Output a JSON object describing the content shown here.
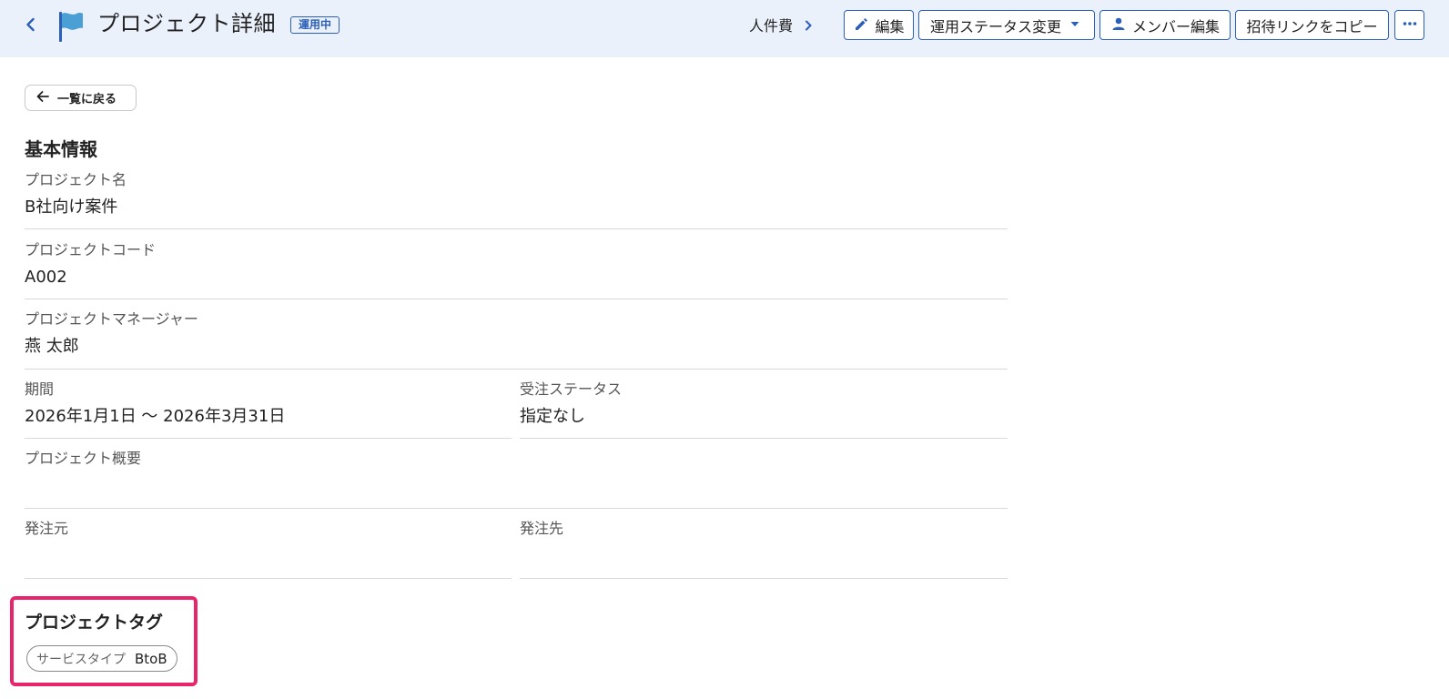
{
  "header": {
    "title": "プロジェクト詳細",
    "status_badge": "運用中",
    "breadcrumb_link": "人件費",
    "buttons": {
      "edit": "編集",
      "status_change": "運用ステータス変更",
      "member_edit": "メンバー編集",
      "copy_invite": "招待リンクをコピー"
    },
    "icons": {
      "back": "chevron-left-icon",
      "flag": "flag-icon",
      "edit": "pencil-icon",
      "status": "caret-down-icon",
      "member": "person-icon",
      "more": "more-horizontal-icon"
    },
    "colors": {
      "accent": "#2b5fb8",
      "flag": "#4a9fd4",
      "header_bg": "#ebf1fb",
      "highlight": "#e8256a"
    }
  },
  "back_button": "一覧に戻る",
  "basic_info": {
    "title": "基本情報",
    "fields": [
      {
        "label": "プロジェクト名",
        "value": "B社向け案件"
      },
      {
        "label": "プロジェクトコード",
        "value": "A002"
      },
      {
        "label": "プロジェクトマネージャー",
        "value": "燕 太郎"
      },
      {
        "label": "期間",
        "value": "2026年1月1日 〜 2026年3月31日"
      },
      {
        "label": "受注ステータス",
        "value": "指定なし"
      },
      {
        "label": "プロジェクト概要",
        "value": ""
      },
      {
        "label": "発注元",
        "value": ""
      },
      {
        "label": "発注先",
        "value": ""
      }
    ]
  },
  "project_tags": {
    "title": "プロジェクトタグ",
    "tags": [
      {
        "key": "サービスタイプ",
        "value": "BtoB"
      }
    ]
  }
}
